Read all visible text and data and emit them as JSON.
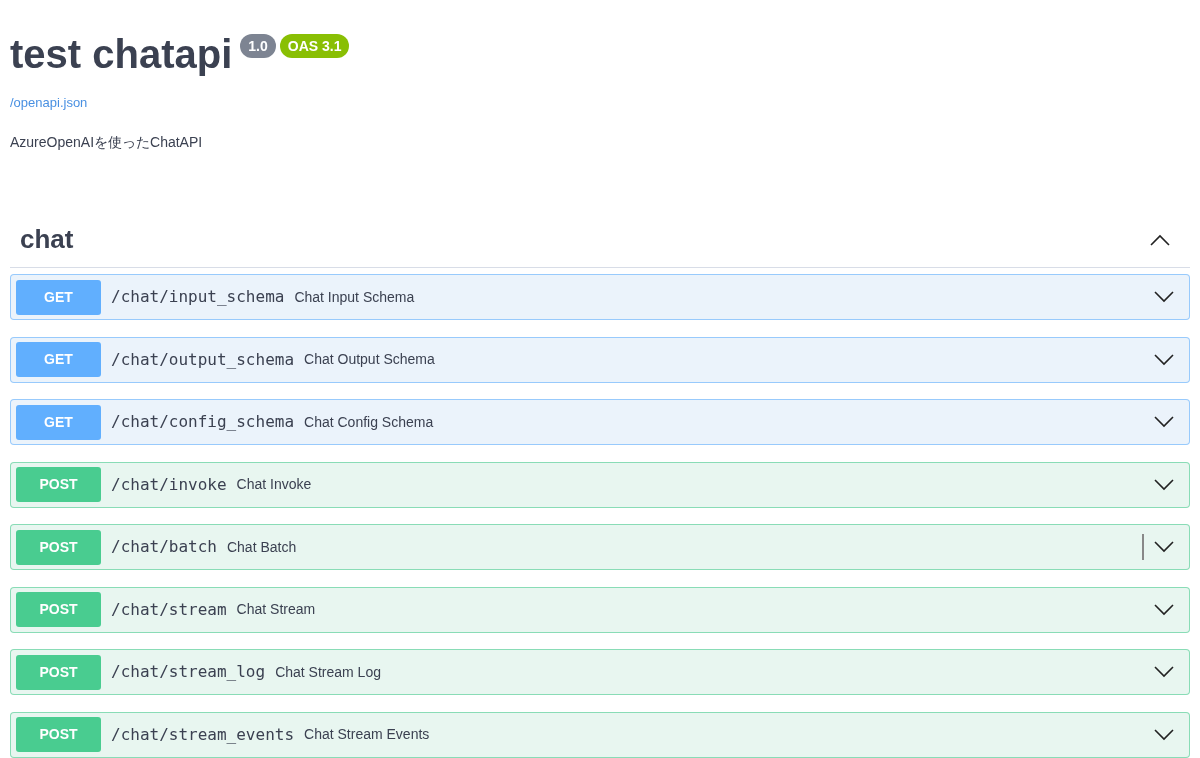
{
  "info": {
    "title": "test chatapi",
    "version": "1.0",
    "oas_version": "OAS 3.1",
    "spec_link": "/openapi.json",
    "description": "AzureOpenAIを使ったChatAPI"
  },
  "section": {
    "name": "chat",
    "expanded": true,
    "operations": [
      {
        "method": "GET",
        "path": "/chat/input_schema",
        "summary": "Chat Input Schema",
        "expanded": false,
        "focused": false
      },
      {
        "method": "GET",
        "path": "/chat/output_schema",
        "summary": "Chat Output Schema",
        "expanded": false,
        "focused": false
      },
      {
        "method": "GET",
        "path": "/chat/config_schema",
        "summary": "Chat Config Schema",
        "expanded": false,
        "focused": false
      },
      {
        "method": "POST",
        "path": "/chat/invoke",
        "summary": "Chat Invoke",
        "expanded": false,
        "focused": false
      },
      {
        "method": "POST",
        "path": "/chat/batch",
        "summary": "Chat Batch",
        "expanded": false,
        "focused": true
      },
      {
        "method": "POST",
        "path": "/chat/stream",
        "summary": "Chat Stream",
        "expanded": false,
        "focused": false
      },
      {
        "method": "POST",
        "path": "/chat/stream_log",
        "summary": "Chat Stream Log",
        "expanded": false,
        "focused": false
      },
      {
        "method": "POST",
        "path": "/chat/stream_events",
        "summary": "Chat Stream Events",
        "expanded": false,
        "focused": false
      }
    ]
  }
}
